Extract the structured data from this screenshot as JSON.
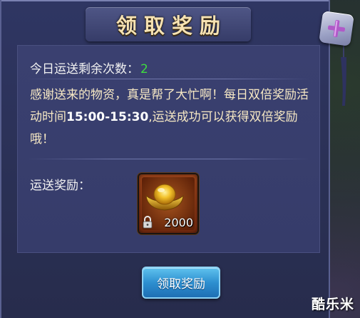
{
  "dialog": {
    "title": "领取奖励",
    "close_icon": "close-plus-icon"
  },
  "remaining": {
    "label": "今日运送剩余次数：",
    "count": "2"
  },
  "description": {
    "line_part1": "感谢送来的物资，真是帮了大忙啊！每日双倍奖励活动时间",
    "time_range": "15:00-15:30",
    "line_part2": ",运送成功可以获得双倍奖励哦！"
  },
  "reward": {
    "label": "运送奖励：",
    "item_icon": "gold-ingot-icon",
    "lock_icon": "lock-icon",
    "amount": "2000"
  },
  "claim_button": {
    "label": "领取奖励"
  },
  "watermark": "酷乐米",
  "colors": {
    "accent_green": "#3fdc3f",
    "title_gold": "#f6e2b2",
    "button_blue": "#2d8fd0"
  }
}
